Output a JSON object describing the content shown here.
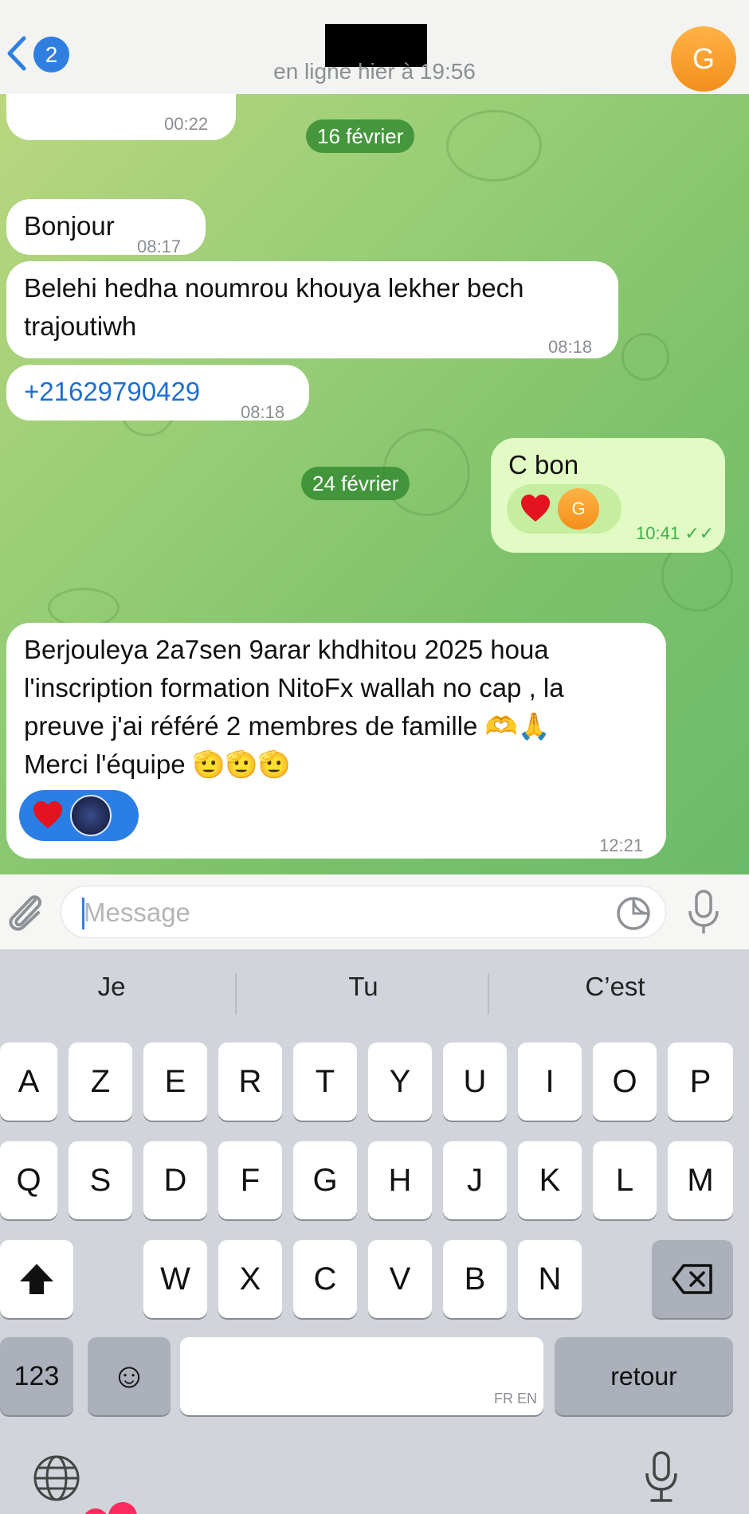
{
  "header": {
    "back_badge": "2",
    "subtitle": "en ligne hier à 19:56",
    "avatar_letter": "G"
  },
  "chat": {
    "prev_reaction_time": "00:22",
    "date1": "16 février",
    "msg1": {
      "text": "Bonjour",
      "time": "08:17"
    },
    "msg2": {
      "line1": "Belehi hedha noumrou khouya lekher bech",
      "line2": "trajoutiwh",
      "time": "08:18"
    },
    "msg3": {
      "text": "+21629790429",
      "time": "08:18"
    },
    "msg4": {
      "text": "C bon",
      "time": "10:41",
      "reaction_avatar": "G",
      "ticks": "✓✓"
    },
    "date2": "24 février",
    "msg5": {
      "line1": "Berjouleya 2a7sen 9arar khdhitou 2025 houa",
      "line2": "l'inscription formation NitoFx wallah no cap , la",
      "line3": "preuve j'ai référé 2 membres de famille 🫶🙏",
      "line4": "Merci l'équipe 🫡🫡🫡",
      "time": "12:21"
    }
  },
  "input": {
    "placeholder": "Message"
  },
  "keyboard": {
    "suggestions": [
      "Je",
      "Tu",
      "C’est"
    ],
    "row1": [
      "A",
      "Z",
      "E",
      "R",
      "T",
      "Y",
      "U",
      "I",
      "O",
      "P"
    ],
    "row2": [
      "Q",
      "S",
      "D",
      "F",
      "G",
      "H",
      "J",
      "K",
      "L",
      "M"
    ],
    "row3": [
      "W",
      "X",
      "C",
      "V",
      "B",
      "N"
    ],
    "numbers_label": "123",
    "emoji_label": "☺",
    "space_lang": "FR EN",
    "return_label": "retour"
  },
  "colors": {
    "accent": "#2f7fe0",
    "date_pill": "#368c32",
    "outgoing_bubble": "#e2fbc4",
    "avatar": "#f5a13a"
  },
  "icons": [
    "back-chevron-icon",
    "heart-icon",
    "paperclip-icon",
    "sticker-icon",
    "microphone-icon",
    "shift-icon",
    "backspace-icon",
    "globe-icon",
    "dictation-icon"
  ]
}
